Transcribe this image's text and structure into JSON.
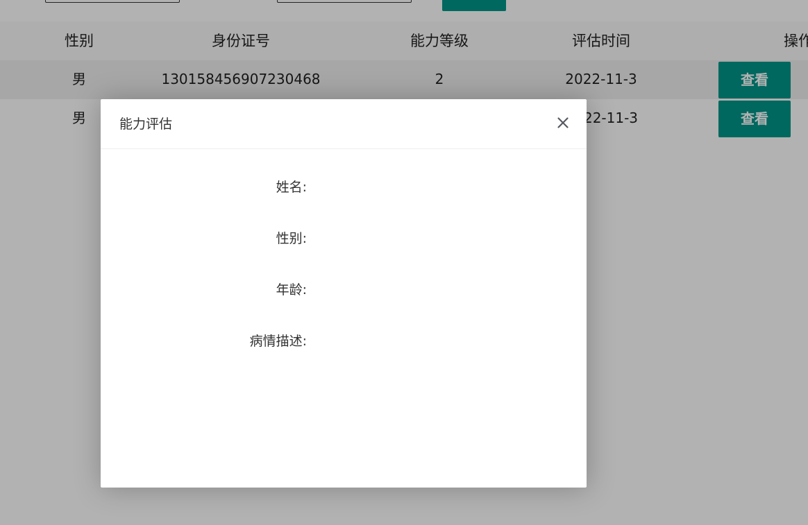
{
  "toolbar": {},
  "table": {
    "headers": [
      "性别",
      "身份证号",
      "能力等级",
      "评估时间",
      "操作"
    ],
    "rows": [
      {
        "gender": "男",
        "id_number": "130158456907230468",
        "level": "2",
        "time": "2022-11-3",
        "action": "查看"
      },
      {
        "gender": "男",
        "id_number": "",
        "level": "",
        "time": "22-11-3",
        "action": "查看"
      }
    ]
  },
  "dialog": {
    "title": "能力评估",
    "fields": [
      {
        "label": "姓名:"
      },
      {
        "label": "性别:"
      },
      {
        "label": "年龄:"
      },
      {
        "label": "病情描述:"
      }
    ]
  },
  "colors": {
    "primary": "#009688",
    "mask": "rgba(0,0,0,0.3)"
  },
  "icons": {
    "close": "close-icon"
  }
}
